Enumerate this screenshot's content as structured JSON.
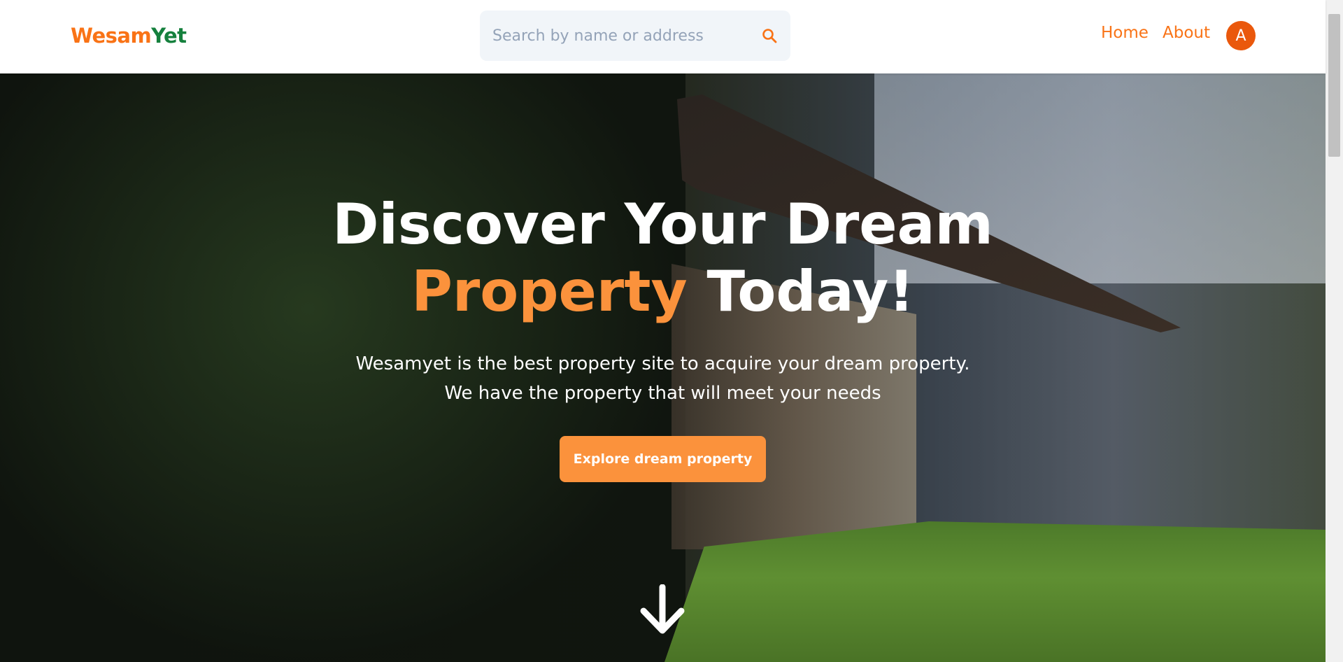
{
  "header": {
    "logo_part1": "Wesam",
    "logo_part2": "Yet",
    "search_placeholder": "Search by name or address",
    "nav": [
      "Home",
      "About"
    ],
    "avatar_initial": "A"
  },
  "hero": {
    "headline_line1": "Discover Your Dream",
    "headline_accent": "Property",
    "headline_rest": "Today!",
    "subtitle_line1": "Wesamyet is the best property site to acquire your dream property.",
    "subtitle_line2": "We have the property that will meet your needs",
    "cta_label": "Explore dream property"
  },
  "colors": {
    "brand_orange": "#f97316",
    "brand_green": "#15803d",
    "cta_orange": "#fb923c",
    "avatar_bg": "#ea580c"
  },
  "icons": [
    "search-icon",
    "arrow-down-icon"
  ]
}
